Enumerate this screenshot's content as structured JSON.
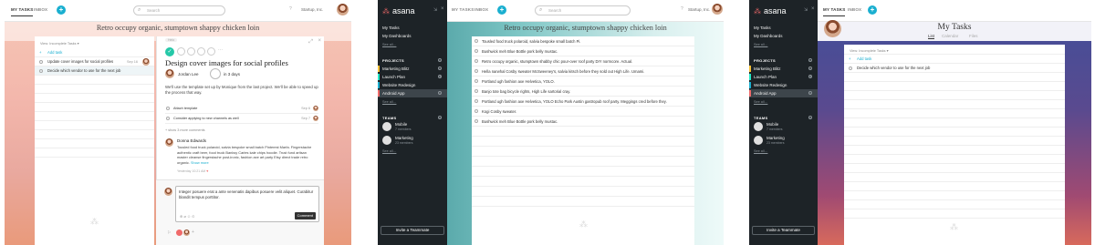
{
  "colors": {
    "accent": "#1aafd0",
    "brand": "#f06a6a",
    "sidebar": "#1d2327",
    "green": "#25e8c8"
  },
  "common": {
    "my_tasks_tab": "MY TASKS",
    "inbox_tab": "INBOX",
    "search_placeholder": "Search",
    "user_name": "Startup, Inc.",
    "help": "?",
    "logo_text": "asana"
  },
  "s1": {
    "title": "Retro occupy organic, stumptown shappy chicken loin",
    "view_filter": "View: Incomplete Tasks ▾",
    "add_task": "Add task",
    "tasks": [
      {
        "name": "Update cover images for social profiles",
        "due": "Sep 16"
      },
      {
        "name": "Decide which vendor to use for the next job",
        "due": ""
      }
    ],
    "detail": {
      "header_badge": "Helo",
      "task_title": "Design cover images for social profiles",
      "assignee": "Jordan Lee",
      "due": "in 3 days",
      "description": "We'll use the template set up by Monique from the last project. We'll be able to speed up the process that way.",
      "subtasks": [
        {
          "name": "Attach template",
          "due": "Sep 6"
        },
        {
          "name": "Consider applying to new channels as well",
          "due": "Sep 7"
        }
      ],
      "show_more": "+ show 3 more comments",
      "comment_author": "Donna Edwards",
      "comment_text": "Tousled food truck polaroid, salvia bespoke small batch Pinterest Marfa. Fingerstache authentic craft beer, food truck Banksy Carles kale chips hoodie. Trust fund artisan master cleanse fingerstache post-ironic, fashion axe art party Etsy direct trade retro organic.",
      "comment_more": "Show more",
      "comment_time": "Yesterday 10:21 AM",
      "reply_text": "Integer posuere erat a ante venenatis dapibus posuere velit aliquet. Curabitur blandit tempus porttitor.",
      "comment_button": "Comment"
    }
  },
  "s2": {
    "title": "Retro occupy organic, stumptown shappy chicken loin",
    "nav": [
      "My Tasks",
      "My Dashboards"
    ],
    "see_all": "See all…",
    "projects_header": "PROJECTS",
    "projects": [
      "Marketing Blitz",
      "Launch Plan",
      "Website Redesign",
      "Android App"
    ],
    "teams_header": "TEAMS",
    "teams": [
      {
        "name": "Mobile",
        "members": "7 members"
      },
      {
        "name": "Marketing",
        "members": "23 members"
      }
    ],
    "invite": "Invite a Teammate",
    "tasks": [
      "Tousled food truck polaroid, salvia bespoke small batch Pi.",
      "Bushwick meh Blue Bottle pork belly mustac.",
      "Retro occupy organic, stumptown shabby chic pour-over roof party DIY normcore. Actual.",
      "Hella narwhal Cosby sweater McSweeney's, salvia kitsch before they sold out High Life. Umami.",
      "Portland ugh fashion axe Helvetica, YOLO.",
      "Banjo tote bag bicycle rights, High Life sartorial cray.",
      "Portland ugh fashion axe Helvetica, YOLO Echo Park Austin gastropub roof party. Meggings cred before they.",
      "Kogi Cosby sweater.",
      "Bushwick meh Blue Bottle pork belly mustac."
    ]
  },
  "s3": {
    "page_title": "My Tasks",
    "tabs": [
      "List",
      "Calendar",
      "Files"
    ],
    "view_filter": "View: Incomplete Tasks ▾",
    "add_task": "Add task",
    "tasks": [
      "Decide which vendor to use for the next job"
    ],
    "nav": [
      "My Tasks",
      "My Dashboards"
    ],
    "see_all": "See all…",
    "projects_header": "PROJECTS",
    "projects": [
      "Marketing Blitz",
      "Launch Plan",
      "Website Redesign",
      "Android App"
    ],
    "teams_header": "TEAMS",
    "teams": [
      {
        "name": "Mobile",
        "members": "7 members"
      },
      {
        "name": "Marketing",
        "members": "23 members"
      }
    ],
    "invite": "Invite a Teammate"
  }
}
